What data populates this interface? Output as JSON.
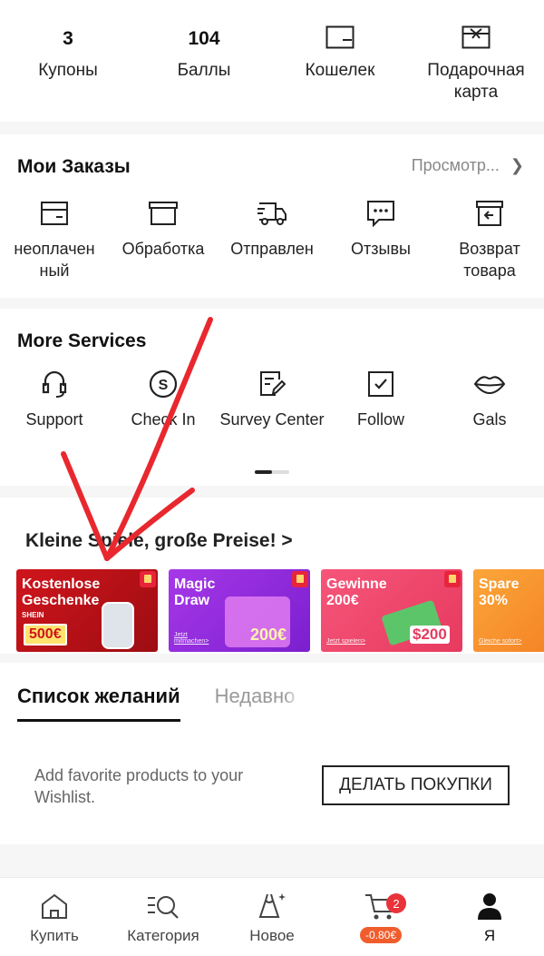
{
  "assets": [
    {
      "value": "3",
      "label": "Купоны",
      "icon": null
    },
    {
      "value": "104",
      "label": "Баллы",
      "icon": null
    },
    {
      "value": null,
      "label": "Кошелек",
      "icon": "wallet-icon"
    },
    {
      "value": null,
      "label": "Подарочная карта",
      "icon": "gift-card-icon"
    }
  ],
  "orders": {
    "title": "Мои Заказы",
    "view_all": "Просмотр...",
    "items": [
      {
        "label": "неоплачен ный",
        "icon": "unpaid-icon"
      },
      {
        "label": "Обработка",
        "icon": "processing-icon"
      },
      {
        "label": "Отправлен",
        "icon": "shipped-icon"
      },
      {
        "label": "Отзывы",
        "icon": "review-icon"
      },
      {
        "label": "Возврат товара",
        "icon": "return-icon"
      }
    ]
  },
  "services": {
    "title": "More Services",
    "items": [
      {
        "label": "Support",
        "icon": "headset-icon"
      },
      {
        "label": "Check In",
        "icon": "check-in-icon"
      },
      {
        "label": "Survey Center",
        "icon": "survey-icon"
      },
      {
        "label": "Follow",
        "icon": "follow-icon"
      },
      {
        "label": "Gals",
        "icon": "lips-icon"
      }
    ]
  },
  "games": {
    "title": "Kleine Spiele, große Preise! >",
    "banners": [
      {
        "title": "Kostenlose Geschenke",
        "sub": "SHEIN",
        "price": "500€",
        "link": "",
        "color": "#c7161c"
      },
      {
        "title": "Magic Draw",
        "sub": "",
        "price": "200€",
        "link": "Jetzt mitmachen>",
        "color": "#8a2be2"
      },
      {
        "title": "Gewinne 200€",
        "sub": "",
        "price": "$200",
        "link": "Jetzt spielen>",
        "color": "#ef4f6f"
      },
      {
        "title": "Spare 30%",
        "sub": "",
        "price": "",
        "link": "Gleiche sofort>",
        "color": "#f7942d"
      }
    ]
  },
  "wishlist": {
    "tab_active": "Список желаний",
    "tab_other": "Недавно",
    "message": "Add favorite products to your Wishlist.",
    "button": "ДЕЛАТЬ ПОКУПКИ"
  },
  "nav": {
    "items": [
      {
        "label": "Купить",
        "icon": "home-icon"
      },
      {
        "label": "Категория",
        "icon": "category-search-icon"
      },
      {
        "label": "Новое",
        "icon": "new-dress-icon"
      },
      {
        "label": "",
        "icon": "cart-icon"
      },
      {
        "label": "Я",
        "icon": "profile-icon"
      }
    ],
    "cart_count": "2",
    "cart_price": "-0.80€"
  },
  "colors": {
    "annotation_arrow": "#e8282e",
    "cart_badge": "#e8333a",
    "price_tag": "#f05d2d"
  }
}
